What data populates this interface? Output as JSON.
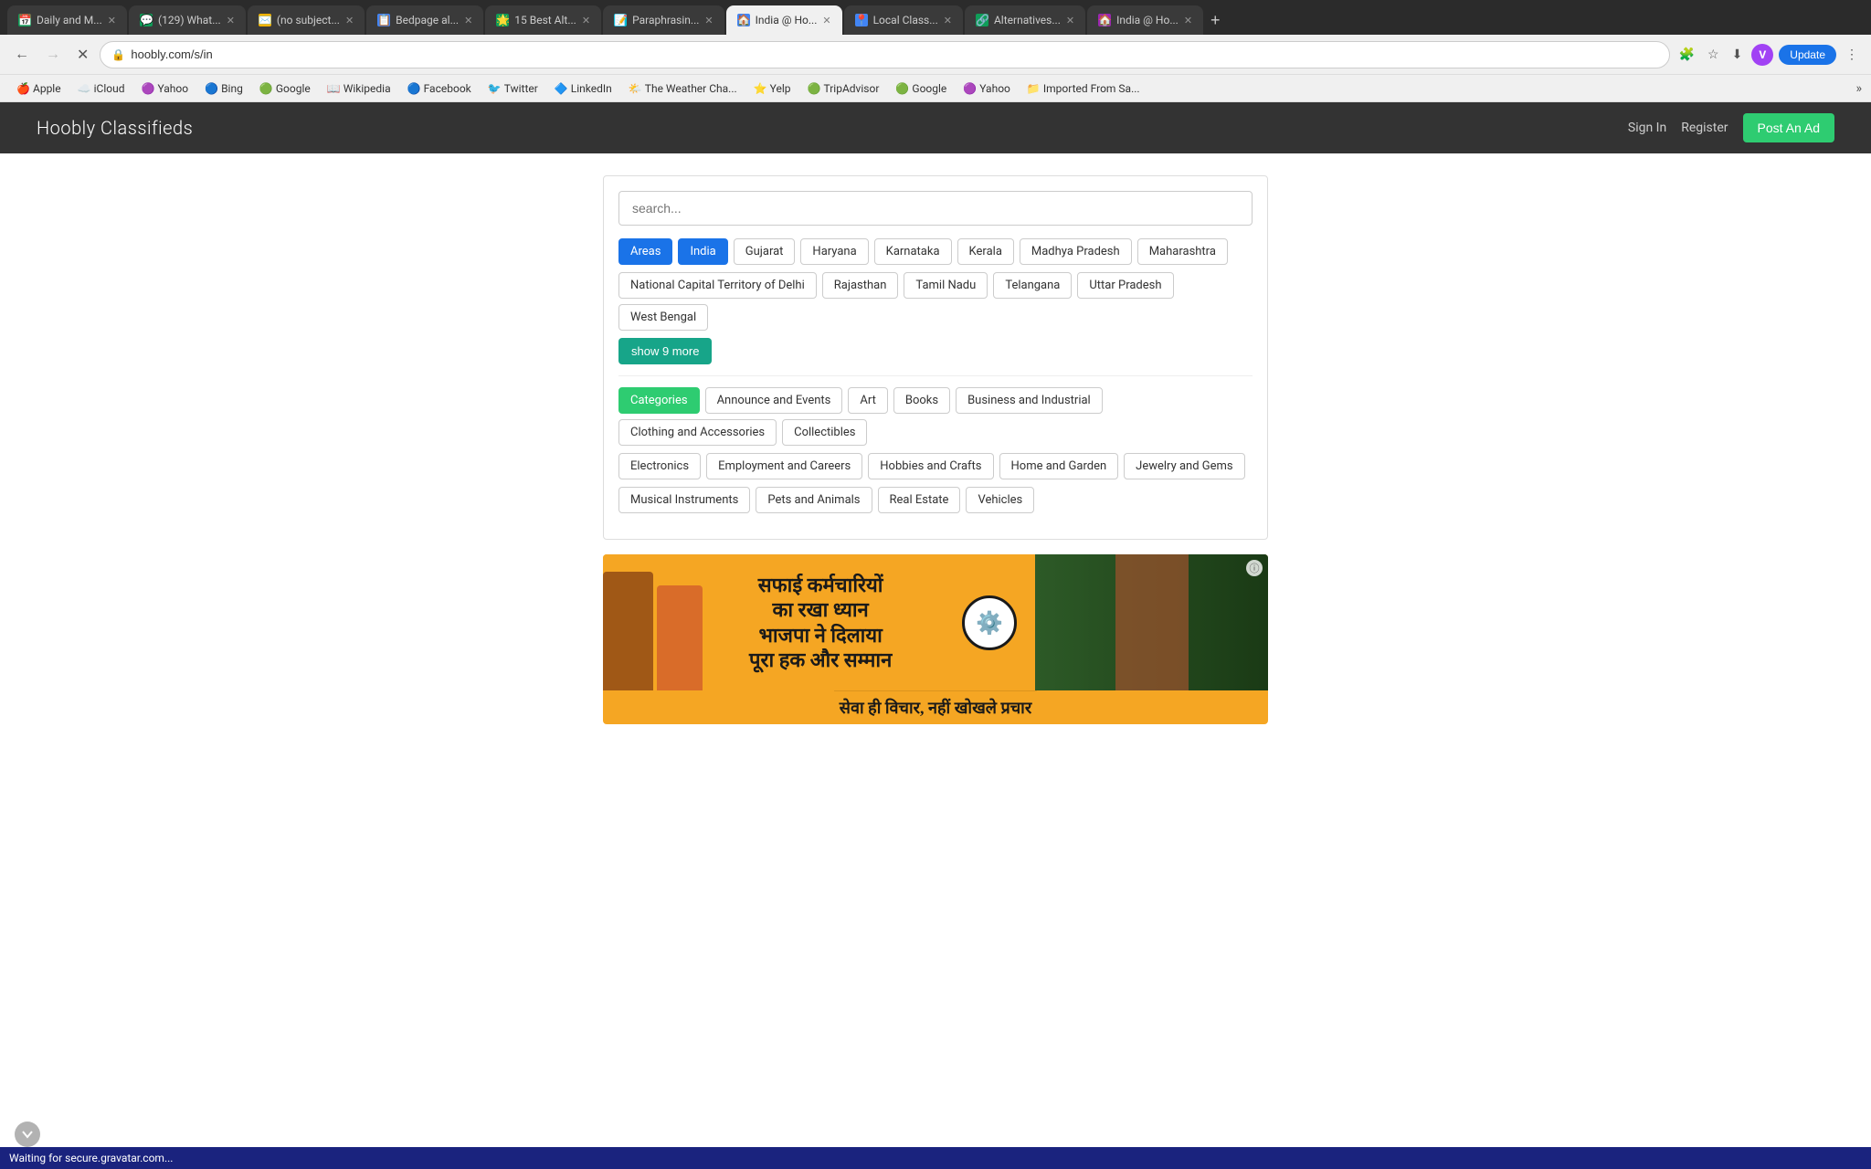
{
  "browser": {
    "tabs": [
      {
        "id": 1,
        "label": "Daily and M...",
        "color": "green",
        "active": false,
        "favicon": "📅"
      },
      {
        "id": 2,
        "label": "(129) What...",
        "color": "green",
        "active": false,
        "favicon": "💬"
      },
      {
        "id": 3,
        "label": "(no subject...",
        "color": "yellow",
        "active": false,
        "favicon": "✉️"
      },
      {
        "id": 4,
        "label": "Bedpage al...",
        "color": "blue",
        "active": false,
        "favicon": "📋"
      },
      {
        "id": 5,
        "label": "15 Best Alt...",
        "color": "green",
        "active": false,
        "favicon": "🌟"
      },
      {
        "id": 6,
        "label": "Paraphrasin...",
        "color": "teal",
        "active": false,
        "favicon": "📝"
      },
      {
        "id": 7,
        "label": "India @ Ho...",
        "color": "blue",
        "active": true,
        "favicon": "🏠"
      },
      {
        "id": 8,
        "label": "Local Class...",
        "color": "blue",
        "active": false,
        "favicon": "📍"
      },
      {
        "id": 9,
        "label": "Alternatives...",
        "color": "green",
        "active": false,
        "favicon": "🔗"
      },
      {
        "id": 10,
        "label": "India @ Ho...",
        "color": "purple",
        "active": false,
        "favicon": "🏠"
      }
    ],
    "address": "hoobly.com/s/in",
    "profile_initial": "V",
    "update_label": "Update",
    "bookmarks": [
      {
        "label": "Apple",
        "favicon": "🍎"
      },
      {
        "label": "iCloud",
        "favicon": "☁️"
      },
      {
        "label": "Yahoo",
        "favicon": "🟣"
      },
      {
        "label": "Bing",
        "favicon": "🔵"
      },
      {
        "label": "Google",
        "favicon": "🟢"
      },
      {
        "label": "Wikipedia",
        "favicon": "📖"
      },
      {
        "label": "Facebook",
        "favicon": "🔵"
      },
      {
        "label": "Twitter",
        "favicon": "🐦"
      },
      {
        "label": "LinkedIn",
        "favicon": "🔷"
      },
      {
        "label": "The Weather Cha...",
        "favicon": "🌤️"
      },
      {
        "label": "Yelp",
        "favicon": "⭐"
      },
      {
        "label": "TripAdvisor",
        "favicon": "🟢"
      },
      {
        "label": "Google",
        "favicon": "🟢"
      },
      {
        "label": "Yahoo",
        "favicon": "🟣"
      },
      {
        "label": "Imported From Sa...",
        "favicon": "📁"
      }
    ]
  },
  "site": {
    "title": "Hoobly Classifieds",
    "nav": {
      "signin": "Sign In",
      "register": "Register",
      "post_ad": "Post An Ad"
    }
  },
  "search": {
    "placeholder": "search..."
  },
  "areas": {
    "label": "Areas",
    "active_label": "India",
    "tags": [
      "Gujarat",
      "Haryana",
      "Karnataka",
      "Kerala",
      "Madhya Pradesh",
      "Maharashtra",
      "National Capital Territory of Delhi",
      "Rajasthan",
      "Tamil Nadu",
      "Telangana",
      "Uttar Pradesh",
      "West Bengal"
    ],
    "show_more": "show 9 more"
  },
  "categories": {
    "label": "Categories",
    "tags": [
      "Announce and Events",
      "Art",
      "Books",
      "Business and Industrial",
      "Clothing and Accessories",
      "Collectibles",
      "Electronics",
      "Employment and Careers",
      "Hobbies and Crafts",
      "Home and Garden",
      "Jewelry and Gems",
      "Musical Instruments",
      "Pets and Animals",
      "Real Estate",
      "Vehicles"
    ]
  },
  "ad_banner": {
    "hindi_line1": "सफाई कर्मचारियों",
    "hindi_line2": "का रखा ध्यान",
    "hindi_line3": "भाजपा ने दिलाया",
    "hindi_line4": "पूरा हक और सम्मान",
    "hindi_bottom": "सेवा ही विचार, नहीं खोखले प्रचार",
    "info_icon": "ⓘ"
  },
  "status_bar": {
    "text": "Waiting for secure.gravatar.com..."
  }
}
